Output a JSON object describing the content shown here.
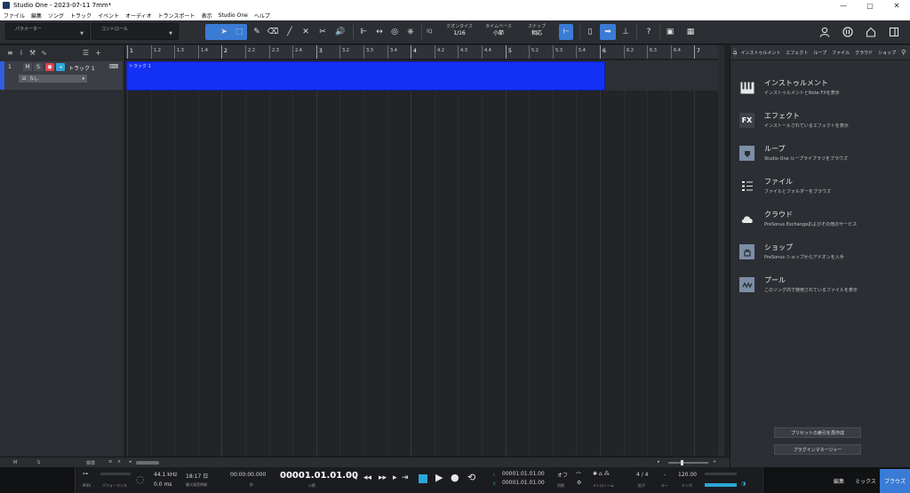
{
  "window": {
    "title": "Studio One - 2023-07-11 7mm*",
    "controls": [
      "—",
      "▢",
      "✕"
    ]
  },
  "menu": [
    "ファイル",
    "編集",
    "ソング",
    "トラック",
    "イベント",
    "オーディオ",
    "トランスポート",
    "表示",
    "Studio One",
    "ヘルプ"
  ],
  "toolbar": {
    "param_label": "パラメーター",
    "control_label": "コントロール",
    "quantize_label": "クオンタイズ",
    "quantize_value": "1/16",
    "timebase_label": "タイムベース",
    "timebase_value": "小節",
    "snap_label": "スナップ",
    "snap_value": "相応",
    "iq_label": "IQ",
    "help_label": "?"
  },
  "tracks": [
    {
      "number": "1",
      "mute": "M",
      "solo": "S",
      "name": "トラック 1",
      "input": "なし",
      "event_name": "トラック 1",
      "color": "#1330f5"
    }
  ],
  "ruler": {
    "labels": [
      "1",
      "1.2",
      "1.3",
      "1.4",
      "2",
      "2.2",
      "2.3",
      "2.4",
      "3",
      "3.2",
      "3.3",
      "3.4",
      "4",
      "4.2",
      "4.3",
      "4.4",
      "5",
      "5.2",
      "5.3",
      "5.4",
      "6",
      "6.2",
      "6.3",
      "6.4",
      "7",
      "7.2"
    ]
  },
  "arrange_bottom": {
    "m": "M",
    "s": "S",
    "std": "標準"
  },
  "browser": {
    "tabs": [
      "インストゥルメント",
      "エフェクト",
      "ループ",
      "ファイル",
      "クラウド",
      "ショップ"
    ],
    "items": [
      {
        "title": "インストゥルメント",
        "desc": "インストゥルメントとNote FXを表示",
        "icon": "piano-icon"
      },
      {
        "title": "エフェクト",
        "desc": "インストールされているエフェクトを表示",
        "icon": "fx-icon"
      },
      {
        "title": "ループ",
        "desc": "Studio One ループライブラリをブラウズ",
        "icon": "loop-icon"
      },
      {
        "title": "ファイル",
        "desc": "ファイルとフォルダーをブラウズ",
        "icon": "file-icon"
      },
      {
        "title": "クラウド",
        "desc": "PreSonus Exchangeおよびその他のサービス",
        "icon": "cloud-icon"
      },
      {
        "title": "ショップ",
        "desc": "PreSonus ショップからアドオンを入手",
        "icon": "shop-icon"
      },
      {
        "title": "プール",
        "desc": "このソング内で使用されているファイルを表示",
        "icon": "pool-icon"
      }
    ],
    "rebuild_button": "プリセットの索引を再作成",
    "plugin_manager_button": "プラグインマネージャー"
  },
  "transport": {
    "midi": "MIDI",
    "performance": "パフォーマンス",
    "sample_rate": "44.1 kHz",
    "latency": "0.0 ms",
    "rec_time": "18:17 日",
    "rec_label": "最大録音時間",
    "time_sec": "00:00:00.000",
    "time_sec_unit": "秒",
    "position": "00001.01.01.00",
    "position_unit": "小節",
    "loop_l": "00001.01.01.00",
    "loop_r": "00001.01.01.00",
    "sync": "オフ",
    "sync_label": "同期",
    "metronome_label": "メトロノーム",
    "signature": "4 / 4",
    "signature_label": "拍子",
    "key_label": "キー",
    "key": "-",
    "tempo": "120.00",
    "tempo_label": "テンポ",
    "tab_edit": "編集",
    "tab_mix": "ミックス",
    "tab_browse": "ブラウズ"
  },
  "colors": {
    "accent": "#3a7bd5",
    "event": "#1330f5",
    "record": "#e0404a",
    "play_stop": "#2aa7d8"
  }
}
